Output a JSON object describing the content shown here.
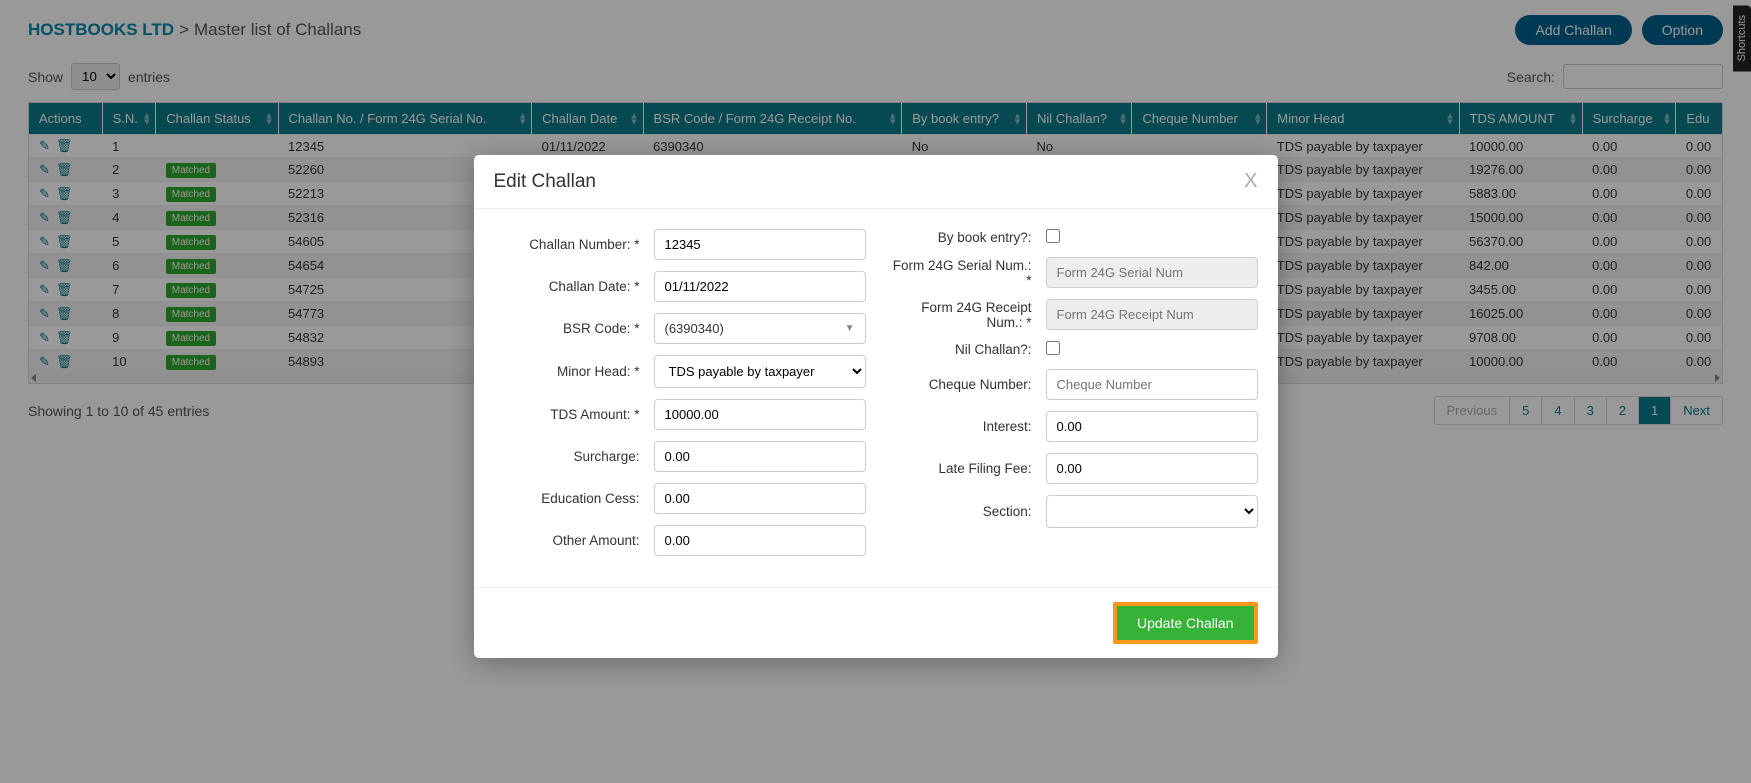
{
  "breadcrumb": {
    "company": "HOSTBOOKS LTD",
    "separator": ">",
    "page": "Master list of Challans"
  },
  "header_buttons": {
    "add_challan": "Add Challan",
    "option": "Option"
  },
  "controls": {
    "show_label": "Show",
    "entries_label": "entries",
    "entries_value": "10",
    "search_label": "Search:"
  },
  "shortcuts_tab": "Shortcuts",
  "columns": {
    "actions": "Actions",
    "sn": "S.N.",
    "status": "Challan Status",
    "challan_no": "Challan No. / Form 24G Serial No.",
    "date": "Challan Date",
    "bsr": "BSR Code / Form 24G Receipt No.",
    "book_entry": "By book entry?",
    "nil": "Nil Challan?",
    "cheque": "Cheque Number",
    "minor_head": "Minor Head",
    "tds_amount": "TDS AMOUNT",
    "surcharge": "Surcharge",
    "edu": "Edu"
  },
  "rows": [
    {
      "sn": "1",
      "status": "",
      "challan_no": "12345",
      "date": "01/11/2022",
      "bsr": "6390340",
      "book_entry": "No",
      "nil": "No",
      "cheque": "",
      "minor_head": "TDS payable by taxpayer",
      "tds": "10000.00",
      "surcharge": "0.00",
      "edu": "0.00"
    },
    {
      "sn": "2",
      "status": "Matched",
      "challan_no": "52260",
      "date": "",
      "bsr": "",
      "book_entry": "",
      "nil": "",
      "cheque": "",
      "minor_head": "TDS payable by taxpayer",
      "tds": "19276.00",
      "surcharge": "0.00",
      "edu": "0.00"
    },
    {
      "sn": "3",
      "status": "Matched",
      "challan_no": "52213",
      "date": "",
      "bsr": "",
      "book_entry": "",
      "nil": "",
      "cheque": "",
      "minor_head": "TDS payable by taxpayer",
      "tds": "5883.00",
      "surcharge": "0.00",
      "edu": "0.00"
    },
    {
      "sn": "4",
      "status": "Matched",
      "challan_no": "52316",
      "date": "",
      "bsr": "",
      "book_entry": "",
      "nil": "",
      "cheque": "",
      "minor_head": "TDS payable by taxpayer",
      "tds": "15000.00",
      "surcharge": "0.00",
      "edu": "0.00"
    },
    {
      "sn": "5",
      "status": "Matched",
      "challan_no": "54605",
      "date": "",
      "bsr": "",
      "book_entry": "",
      "nil": "",
      "cheque": "",
      "minor_head": "TDS payable by taxpayer",
      "tds": "56370.00",
      "surcharge": "0.00",
      "edu": "0.00"
    },
    {
      "sn": "6",
      "status": "Matched",
      "challan_no": "54654",
      "date": "",
      "bsr": "",
      "book_entry": "",
      "nil": "",
      "cheque": "",
      "minor_head": "TDS payable by taxpayer",
      "tds": "842.00",
      "surcharge": "0.00",
      "edu": "0.00"
    },
    {
      "sn": "7",
      "status": "Matched",
      "challan_no": "54725",
      "date": "",
      "bsr": "",
      "book_entry": "",
      "nil": "",
      "cheque": "",
      "minor_head": "TDS payable by taxpayer",
      "tds": "3455.00",
      "surcharge": "0.00",
      "edu": "0.00"
    },
    {
      "sn": "8",
      "status": "Matched",
      "challan_no": "54773",
      "date": "",
      "bsr": "",
      "book_entry": "",
      "nil": "",
      "cheque": "",
      "minor_head": "TDS payable by taxpayer",
      "tds": "16025.00",
      "surcharge": "0.00",
      "edu": "0.00"
    },
    {
      "sn": "9",
      "status": "Matched",
      "challan_no": "54832",
      "date": "",
      "bsr": "",
      "book_entry": "",
      "nil": "",
      "cheque": "",
      "minor_head": "TDS payable by taxpayer",
      "tds": "9708.00",
      "surcharge": "0.00",
      "edu": "0.00"
    },
    {
      "sn": "10",
      "status": "Matched",
      "challan_no": "54893",
      "date": "",
      "bsr": "",
      "book_entry": "",
      "nil": "",
      "cheque": "",
      "minor_head": "TDS payable by taxpayer",
      "tds": "10000.00",
      "surcharge": "0.00",
      "edu": "0.00"
    }
  ],
  "footer": {
    "showing": "Showing 1 to 10 of 45 entries"
  },
  "pagination": {
    "previous": "Previous",
    "pages": [
      "1",
      "2",
      "3",
      "4",
      "5"
    ],
    "next": "Next",
    "active": "1"
  },
  "modal": {
    "title": "Edit Challan",
    "close": "X",
    "labels": {
      "challan_number": "Challan Number: *",
      "challan_date": "Challan Date: *",
      "bsr_code": "BSR Code: *",
      "minor_head": "Minor Head: *",
      "tds_amount": "TDS Amount: *",
      "surcharge": "Surcharge:",
      "education_cess": "Education Cess:",
      "other_amount": "Other Amount:",
      "by_book_entry": "By book entry?:",
      "form_24g_serial": "Form 24G Serial Num.: *",
      "form_24g_receipt": "Form 24G Receipt Num.: *",
      "nil_challan": "Nil Challan?:",
      "cheque_number": "Cheque Number:",
      "interest": "Interest:",
      "late_filing_fee": "Late Filing Fee:",
      "section": "Section:"
    },
    "values": {
      "challan_number": "12345",
      "challan_date": "01/11/2022",
      "bsr_code": "(6390340)",
      "minor_head": "TDS payable by taxpayer",
      "tds_amount": "10000.00",
      "surcharge": "0.00",
      "education_cess": "0.00",
      "other_amount": "0.00",
      "interest": "0.00",
      "late_filing_fee": "0.00"
    },
    "placeholders": {
      "form_24g_serial": "Form 24G Serial Num",
      "form_24g_receipt": "Form 24G Receipt Num",
      "cheque_number": "Cheque Number"
    },
    "update_button": "Update Challan"
  }
}
